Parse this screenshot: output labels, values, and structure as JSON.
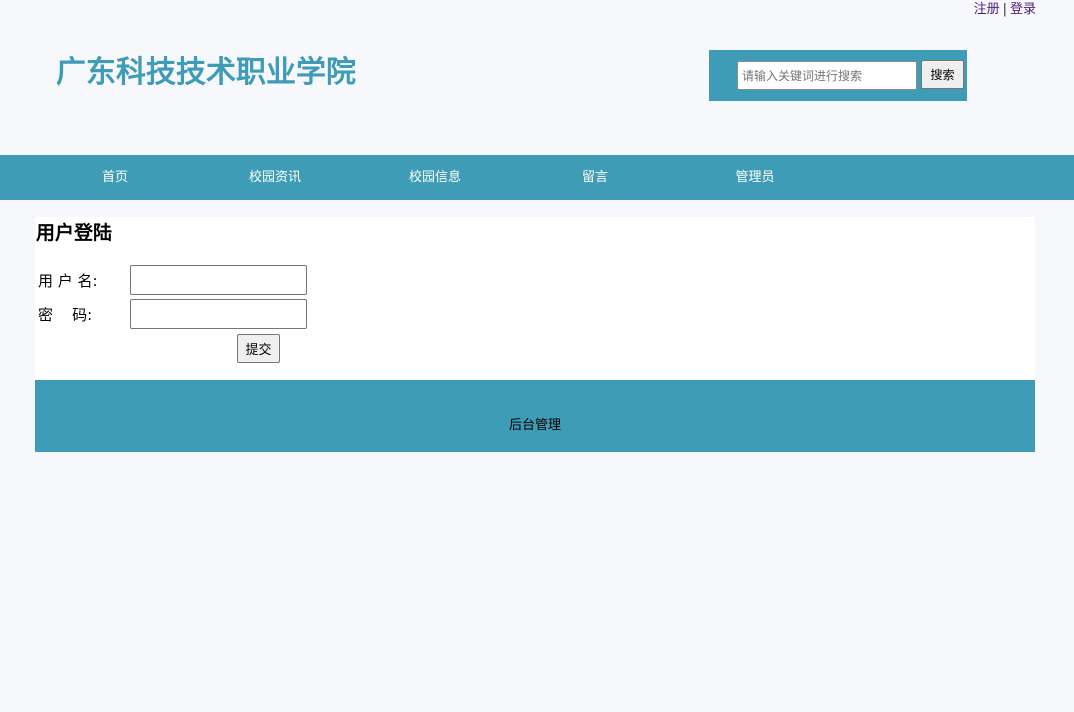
{
  "auth": {
    "register_label": "注册",
    "separator": "|",
    "login_label": "登录"
  },
  "header": {
    "site_title": "广东科技技术职业学院",
    "search": {
      "placeholder": "请输入关键词进行搜索",
      "value": "",
      "button_label": "搜索"
    }
  },
  "nav": {
    "items": [
      {
        "label": "首页"
      },
      {
        "label": "校园资讯"
      },
      {
        "label": "校园信息"
      },
      {
        "label": "留言"
      },
      {
        "label": "管理员"
      }
    ]
  },
  "login": {
    "title": "用户登陆",
    "username_label": "用 户 名:",
    "username_value": "",
    "password_label": "密    码:",
    "password_value": "",
    "submit_label": "提交"
  },
  "footer": {
    "admin_link_label": "后台管理"
  },
  "colors": {
    "accent": "#3f9cb6",
    "page_background": "#f7f8fc",
    "panel_background": "#ffffff",
    "auth_link": "#4b1f78"
  }
}
